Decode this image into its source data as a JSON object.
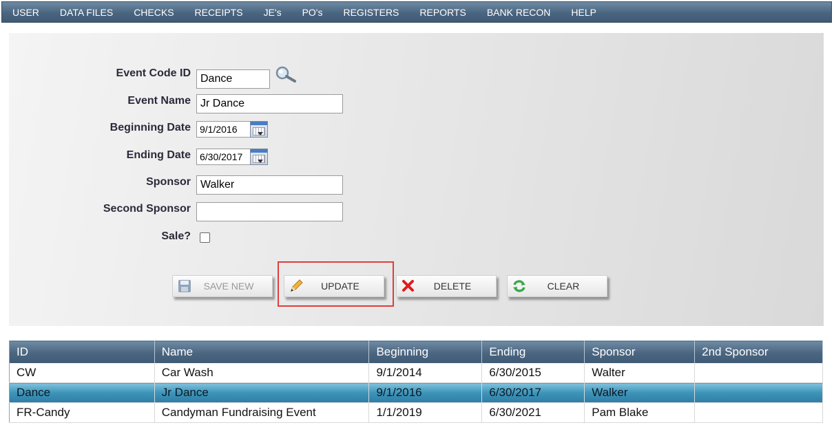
{
  "menu": [
    "USER",
    "DATA FILES",
    "CHECKS",
    "RECEIPTS",
    "JE's",
    "PO's",
    "REGISTERS",
    "REPORTS",
    "BANK RECON",
    "HELP"
  ],
  "form": {
    "event_code_label": "Event Code ID",
    "event_code_value": "Dance",
    "event_name_label": "Event Name",
    "event_name_value": "Jr Dance",
    "beginning_date_label": "Beginning Date",
    "beginning_date_value": "9/1/2016",
    "ending_date_label": "Ending Date",
    "ending_date_value": "6/30/2017",
    "sponsor_label": "Sponsor",
    "sponsor_value": "Walker",
    "second_sponsor_label": "Second Sponsor",
    "second_sponsor_value": "",
    "sale_label": "Sale?",
    "sale_checked": false
  },
  "buttons": {
    "save_new": "SAVE NEW",
    "update": "UPDATE",
    "delete": "DELETE",
    "clear": "CLEAR"
  },
  "table": {
    "headers": [
      "ID",
      "Name",
      "Beginning",
      "Ending",
      "Sponsor",
      "2nd Sponsor"
    ],
    "rows": [
      [
        "CW",
        "Car Wash",
        "9/1/2014",
        "6/30/2015",
        "Walter",
        ""
      ],
      [
        "Dance",
        "Jr Dance",
        "9/1/2016",
        "6/30/2017",
        "Walker",
        ""
      ],
      [
        "FR-Candy",
        "Candyman Fundraising Event",
        "1/1/2019",
        "6/30/2021",
        "Pam Blake",
        ""
      ]
    ],
    "selected_row": 1
  },
  "colors": {
    "menu_bar": "#4a6580",
    "selected_row": "#3d93b9",
    "highlight_border": "#e03c3c"
  }
}
